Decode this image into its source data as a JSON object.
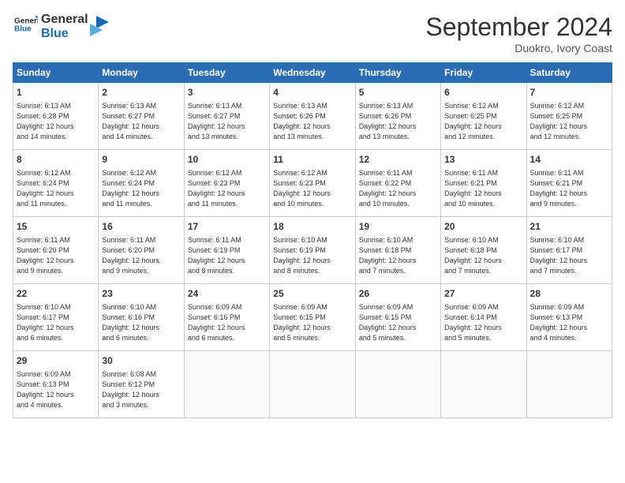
{
  "logo": {
    "line1": "General",
    "line2": "Blue"
  },
  "title": "September 2024",
  "subtitle": "Duokro, Ivory Coast",
  "weekdays": [
    "Sunday",
    "Monday",
    "Tuesday",
    "Wednesday",
    "Thursday",
    "Friday",
    "Saturday"
  ],
  "weeks": [
    [
      {
        "day": "1",
        "info": "Sunrise: 6:13 AM\nSunset: 6:28 PM\nDaylight: 12 hours\nand 14 minutes."
      },
      {
        "day": "2",
        "info": "Sunrise: 6:13 AM\nSunset: 6:27 PM\nDaylight: 12 hours\nand 14 minutes."
      },
      {
        "day": "3",
        "info": "Sunrise: 6:13 AM\nSunset: 6:27 PM\nDaylight: 12 hours\nand 13 minutes."
      },
      {
        "day": "4",
        "info": "Sunrise: 6:13 AM\nSunset: 6:26 PM\nDaylight: 12 hours\nand 13 minutes."
      },
      {
        "day": "5",
        "info": "Sunrise: 6:13 AM\nSunset: 6:26 PM\nDaylight: 12 hours\nand 13 minutes."
      },
      {
        "day": "6",
        "info": "Sunrise: 6:12 AM\nSunset: 6:25 PM\nDaylight: 12 hours\nand 12 minutes."
      },
      {
        "day": "7",
        "info": "Sunrise: 6:12 AM\nSunset: 6:25 PM\nDaylight: 12 hours\nand 12 minutes."
      }
    ],
    [
      {
        "day": "8",
        "info": "Sunrise: 6:12 AM\nSunset: 6:24 PM\nDaylight: 12 hours\nand 11 minutes."
      },
      {
        "day": "9",
        "info": "Sunrise: 6:12 AM\nSunset: 6:24 PM\nDaylight: 12 hours\nand 11 minutes."
      },
      {
        "day": "10",
        "info": "Sunrise: 6:12 AM\nSunset: 6:23 PM\nDaylight: 12 hours\nand 11 minutes."
      },
      {
        "day": "11",
        "info": "Sunrise: 6:12 AM\nSunset: 6:23 PM\nDaylight: 12 hours\nand 10 minutes."
      },
      {
        "day": "12",
        "info": "Sunrise: 6:11 AM\nSunset: 6:22 PM\nDaylight: 12 hours\nand 10 minutes."
      },
      {
        "day": "13",
        "info": "Sunrise: 6:11 AM\nSunset: 6:21 PM\nDaylight: 12 hours\nand 10 minutes."
      },
      {
        "day": "14",
        "info": "Sunrise: 6:11 AM\nSunset: 6:21 PM\nDaylight: 12 hours\nand 9 minutes."
      }
    ],
    [
      {
        "day": "15",
        "info": "Sunrise: 6:11 AM\nSunset: 6:20 PM\nDaylight: 12 hours\nand 9 minutes."
      },
      {
        "day": "16",
        "info": "Sunrise: 6:11 AM\nSunset: 6:20 PM\nDaylight: 12 hours\nand 9 minutes."
      },
      {
        "day": "17",
        "info": "Sunrise: 6:11 AM\nSunset: 6:19 PM\nDaylight: 12 hours\nand 8 minutes."
      },
      {
        "day": "18",
        "info": "Sunrise: 6:10 AM\nSunset: 6:19 PM\nDaylight: 12 hours\nand 8 minutes."
      },
      {
        "day": "19",
        "info": "Sunrise: 6:10 AM\nSunset: 6:18 PM\nDaylight: 12 hours\nand 7 minutes."
      },
      {
        "day": "20",
        "info": "Sunrise: 6:10 AM\nSunset: 6:18 PM\nDaylight: 12 hours\nand 7 minutes."
      },
      {
        "day": "21",
        "info": "Sunrise: 6:10 AM\nSunset: 6:17 PM\nDaylight: 12 hours\nand 7 minutes."
      }
    ],
    [
      {
        "day": "22",
        "info": "Sunrise: 6:10 AM\nSunset: 6:17 PM\nDaylight: 12 hours\nand 6 minutes."
      },
      {
        "day": "23",
        "info": "Sunrise: 6:10 AM\nSunset: 6:16 PM\nDaylight: 12 hours\nand 6 minutes."
      },
      {
        "day": "24",
        "info": "Sunrise: 6:09 AM\nSunset: 6:16 PM\nDaylight: 12 hours\nand 6 minutes."
      },
      {
        "day": "25",
        "info": "Sunrise: 6:09 AM\nSunset: 6:15 PM\nDaylight: 12 hours\nand 5 minutes."
      },
      {
        "day": "26",
        "info": "Sunrise: 6:09 AM\nSunset: 6:15 PM\nDaylight: 12 hours\nand 5 minutes."
      },
      {
        "day": "27",
        "info": "Sunrise: 6:09 AM\nSunset: 6:14 PM\nDaylight: 12 hours\nand 5 minutes."
      },
      {
        "day": "28",
        "info": "Sunrise: 6:09 AM\nSunset: 6:13 PM\nDaylight: 12 hours\nand 4 minutes."
      }
    ],
    [
      {
        "day": "29",
        "info": "Sunrise: 6:09 AM\nSunset: 6:13 PM\nDaylight: 12 hours\nand 4 minutes."
      },
      {
        "day": "30",
        "info": "Sunrise: 6:08 AM\nSunset: 6:12 PM\nDaylight: 12 hours\nand 3 minutes."
      },
      {
        "day": "",
        "info": ""
      },
      {
        "day": "",
        "info": ""
      },
      {
        "day": "",
        "info": ""
      },
      {
        "day": "",
        "info": ""
      },
      {
        "day": "",
        "info": ""
      }
    ]
  ]
}
